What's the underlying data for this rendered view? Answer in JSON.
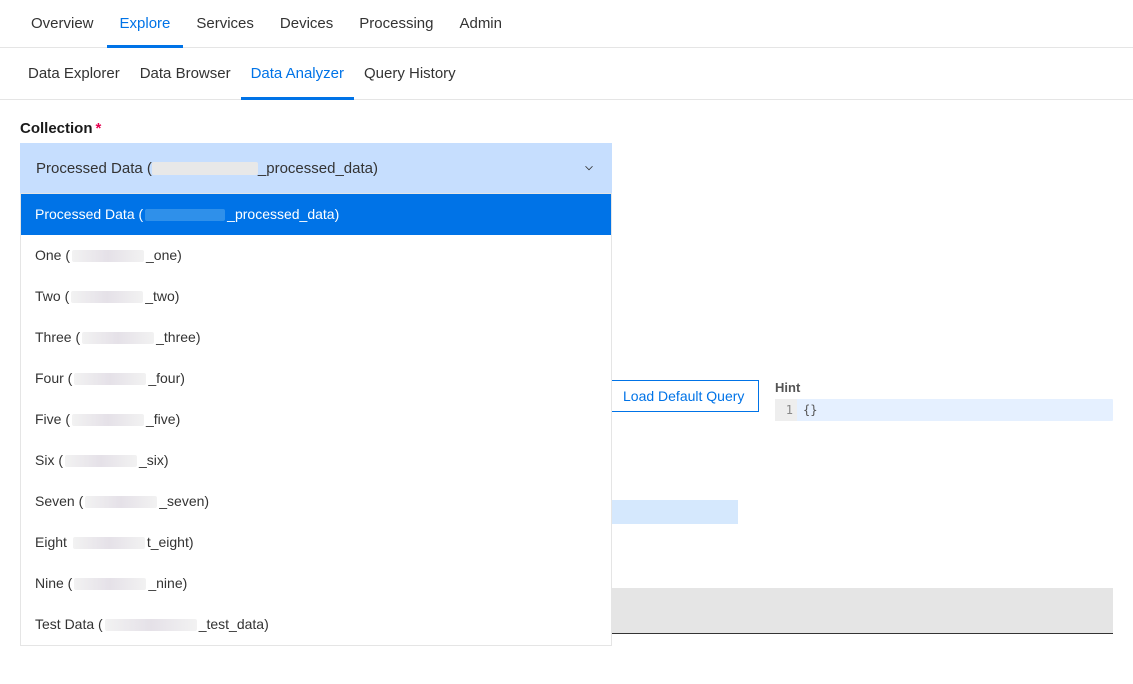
{
  "top_nav": {
    "items": [
      {
        "label": "Overview",
        "active": false
      },
      {
        "label": "Explore",
        "active": true
      },
      {
        "label": "Services",
        "active": false
      },
      {
        "label": "Devices",
        "active": false
      },
      {
        "label": "Processing",
        "active": false
      },
      {
        "label": "Admin",
        "active": false
      }
    ]
  },
  "sub_nav": {
    "items": [
      {
        "label": "Data Explorer",
        "active": false
      },
      {
        "label": "Data Browser",
        "active": false
      },
      {
        "label": "Data Analyzer",
        "active": true
      },
      {
        "label": "Query History",
        "active": false
      }
    ]
  },
  "field": {
    "label": "Collection",
    "required_marker": "*",
    "selected_prefix": "Processed Data (",
    "selected_suffix": "_processed_data)"
  },
  "dropdown": {
    "options": [
      {
        "prefix": "Processed Data (",
        "suffix": "_processed_data)",
        "selected": true
      },
      {
        "prefix": "One (",
        "suffix": "_one)",
        "selected": false
      },
      {
        "prefix": "Two (",
        "suffix": "_two)",
        "selected": false
      },
      {
        "prefix": "Three (",
        "suffix": "_three)",
        "selected": false
      },
      {
        "prefix": "Four (",
        "suffix": "_four)",
        "selected": false
      },
      {
        "prefix": "Five (",
        "suffix": "_five)",
        "selected": false
      },
      {
        "prefix": "Six (",
        "suffix": "_six)",
        "selected": false
      },
      {
        "prefix": "Seven (",
        "suffix": "_seven)",
        "selected": false
      },
      {
        "prefix": "Eight ",
        "suffix": "t_eight)",
        "selected": false
      },
      {
        "prefix": "Nine (",
        "suffix": "_nine)",
        "selected": false
      },
      {
        "prefix": "Test Data (",
        "suffix": "_test_data)",
        "selected": false
      }
    ]
  },
  "actions": {
    "load_default_query": "Load Default Query"
  },
  "hint": {
    "label": "Hint",
    "gutter": "1",
    "code": "{}"
  }
}
